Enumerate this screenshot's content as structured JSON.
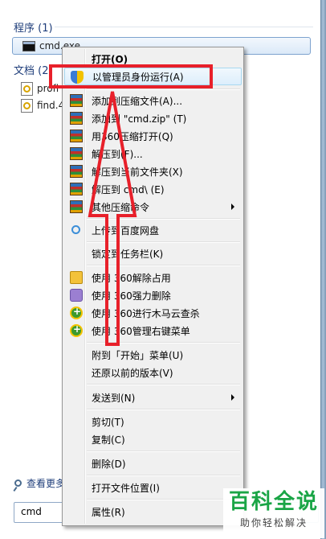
{
  "results": {
    "programs_header": "程序 (1)",
    "programs": [
      {
        "label": "cmd.exe",
        "icon": "cmd-icon"
      }
    ],
    "documents_header": "文档 (2",
    "documents": [
      {
        "label": "profi",
        "icon": "document-icon"
      },
      {
        "label": "find.4",
        "icon": "document-icon"
      }
    ],
    "see_more": "查看更多"
  },
  "search": {
    "value": "cmd"
  },
  "context_menu": {
    "items": [
      {
        "label": "打开(O)",
        "bold": true
      },
      {
        "label": "以管理员身份运行(A)",
        "icon": "uac-shield-icon"
      },
      {
        "label": "添加到压缩文件(A)...",
        "icon": "archive-icon"
      },
      {
        "label": "添加到 \"cmd.zip\" (T)",
        "icon": "archive-icon"
      },
      {
        "label": "用360压缩打开(Q)",
        "icon": "archive-icon"
      },
      {
        "label": "解压到(F)...",
        "icon": "archive-icon"
      },
      {
        "label": "解压到当前文件夹(X)",
        "icon": "archive-icon"
      },
      {
        "label": "解压到 cmd\\ (E)",
        "icon": "archive-icon"
      },
      {
        "label": "其他压缩命令",
        "icon": "archive-icon",
        "submenu": true
      },
      {
        "label": "上传到百度网盘",
        "icon": "baidu-cloud-icon"
      },
      {
        "label": "锁定到任务栏(K)"
      },
      {
        "label": "使用 360解除占用",
        "icon": "unlock-icon"
      },
      {
        "label": "使用 360强力删除",
        "icon": "erase-icon"
      },
      {
        "label": "使用 360进行木马云查杀",
        "icon": "360-shield-icon"
      },
      {
        "label": "使用 360管理右键菜单",
        "icon": "360-shield-icon"
      },
      {
        "label": "附到「开始」菜单(U)"
      },
      {
        "label": "还原以前的版本(V)"
      },
      {
        "label": "发送到(N)",
        "submenu": true
      },
      {
        "label": "剪切(T)"
      },
      {
        "label": "复制(C)"
      },
      {
        "label": "删除(D)"
      },
      {
        "label": "打开文件位置(I)"
      },
      {
        "label": "属性(R)"
      }
    ]
  },
  "annotation": {
    "highlight_color": "#e8202a"
  },
  "watermark": {
    "title": "百科全说",
    "subtitle": "助你轻松解决"
  }
}
